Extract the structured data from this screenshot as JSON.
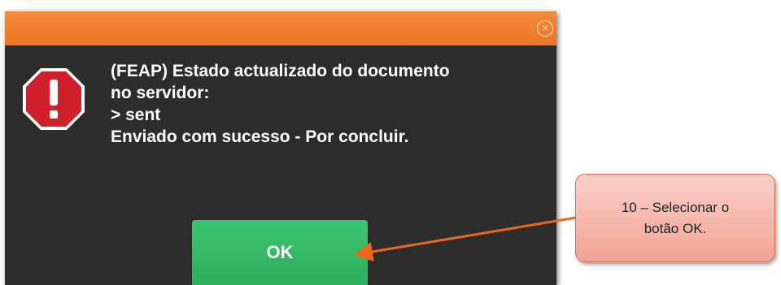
{
  "dialog": {
    "close_symbol": "×",
    "message_lines": [
      "(FEAP) Estado actualizado do documento",
      "no servidor:",
      "> sent",
      "Enviado com sucesso - Por concluir."
    ],
    "ok_label": "OK",
    "icon": "stop-error-icon"
  },
  "annotation": {
    "lines": [
      "10 – Selecionar o",
      "botão OK."
    ]
  },
  "colors": {
    "header": "#f07a2a",
    "dialog_background": "#2c2c2c",
    "ok_button": "#35b865",
    "stop_icon": "#d0202b",
    "callout_fill": "#f6b4a8",
    "arrow": "#e8681e"
  }
}
